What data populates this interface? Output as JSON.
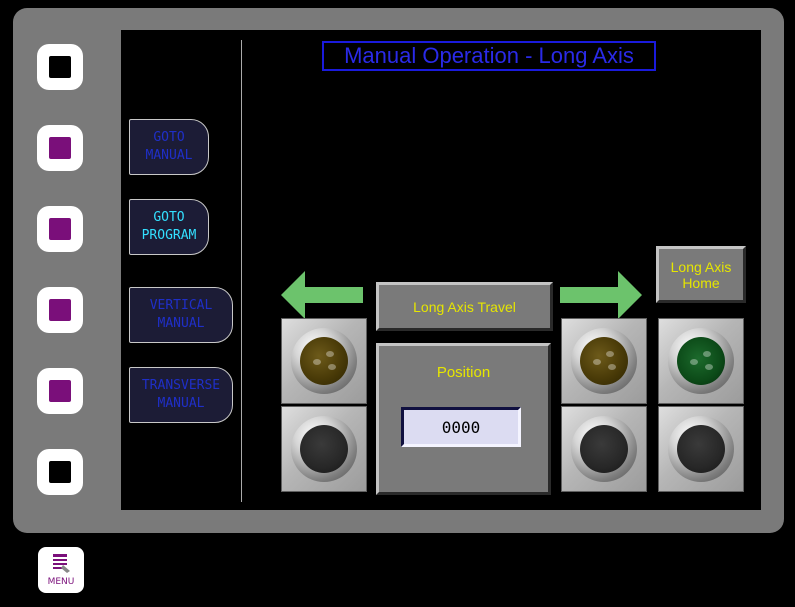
{
  "title": "Manual Operation - Long Axis",
  "nav": {
    "goto_manual": "GOTO\nMANUAL",
    "goto_program": "GOTO\nPROGRAM",
    "vertical_manual": "VERTICAL\nMANUAL",
    "transverse_manual": "TRANSVERSE\nMANUAL"
  },
  "travel_label": "Long Axis Travel",
  "home_label": "Long Axis\nHome",
  "position": {
    "label": "Position",
    "value": "0000"
  },
  "menu_label": "MENU",
  "colors": {
    "bezel": "#7a7a7a",
    "title": "#2a2ae8",
    "accent_text": "#e6e600",
    "arrow": "#6cc36c",
    "softkey_purple": "#7a0f7a"
  },
  "indicators": {
    "left_travel": "amber-off",
    "right_travel": "amber-off",
    "home": "green-off"
  }
}
